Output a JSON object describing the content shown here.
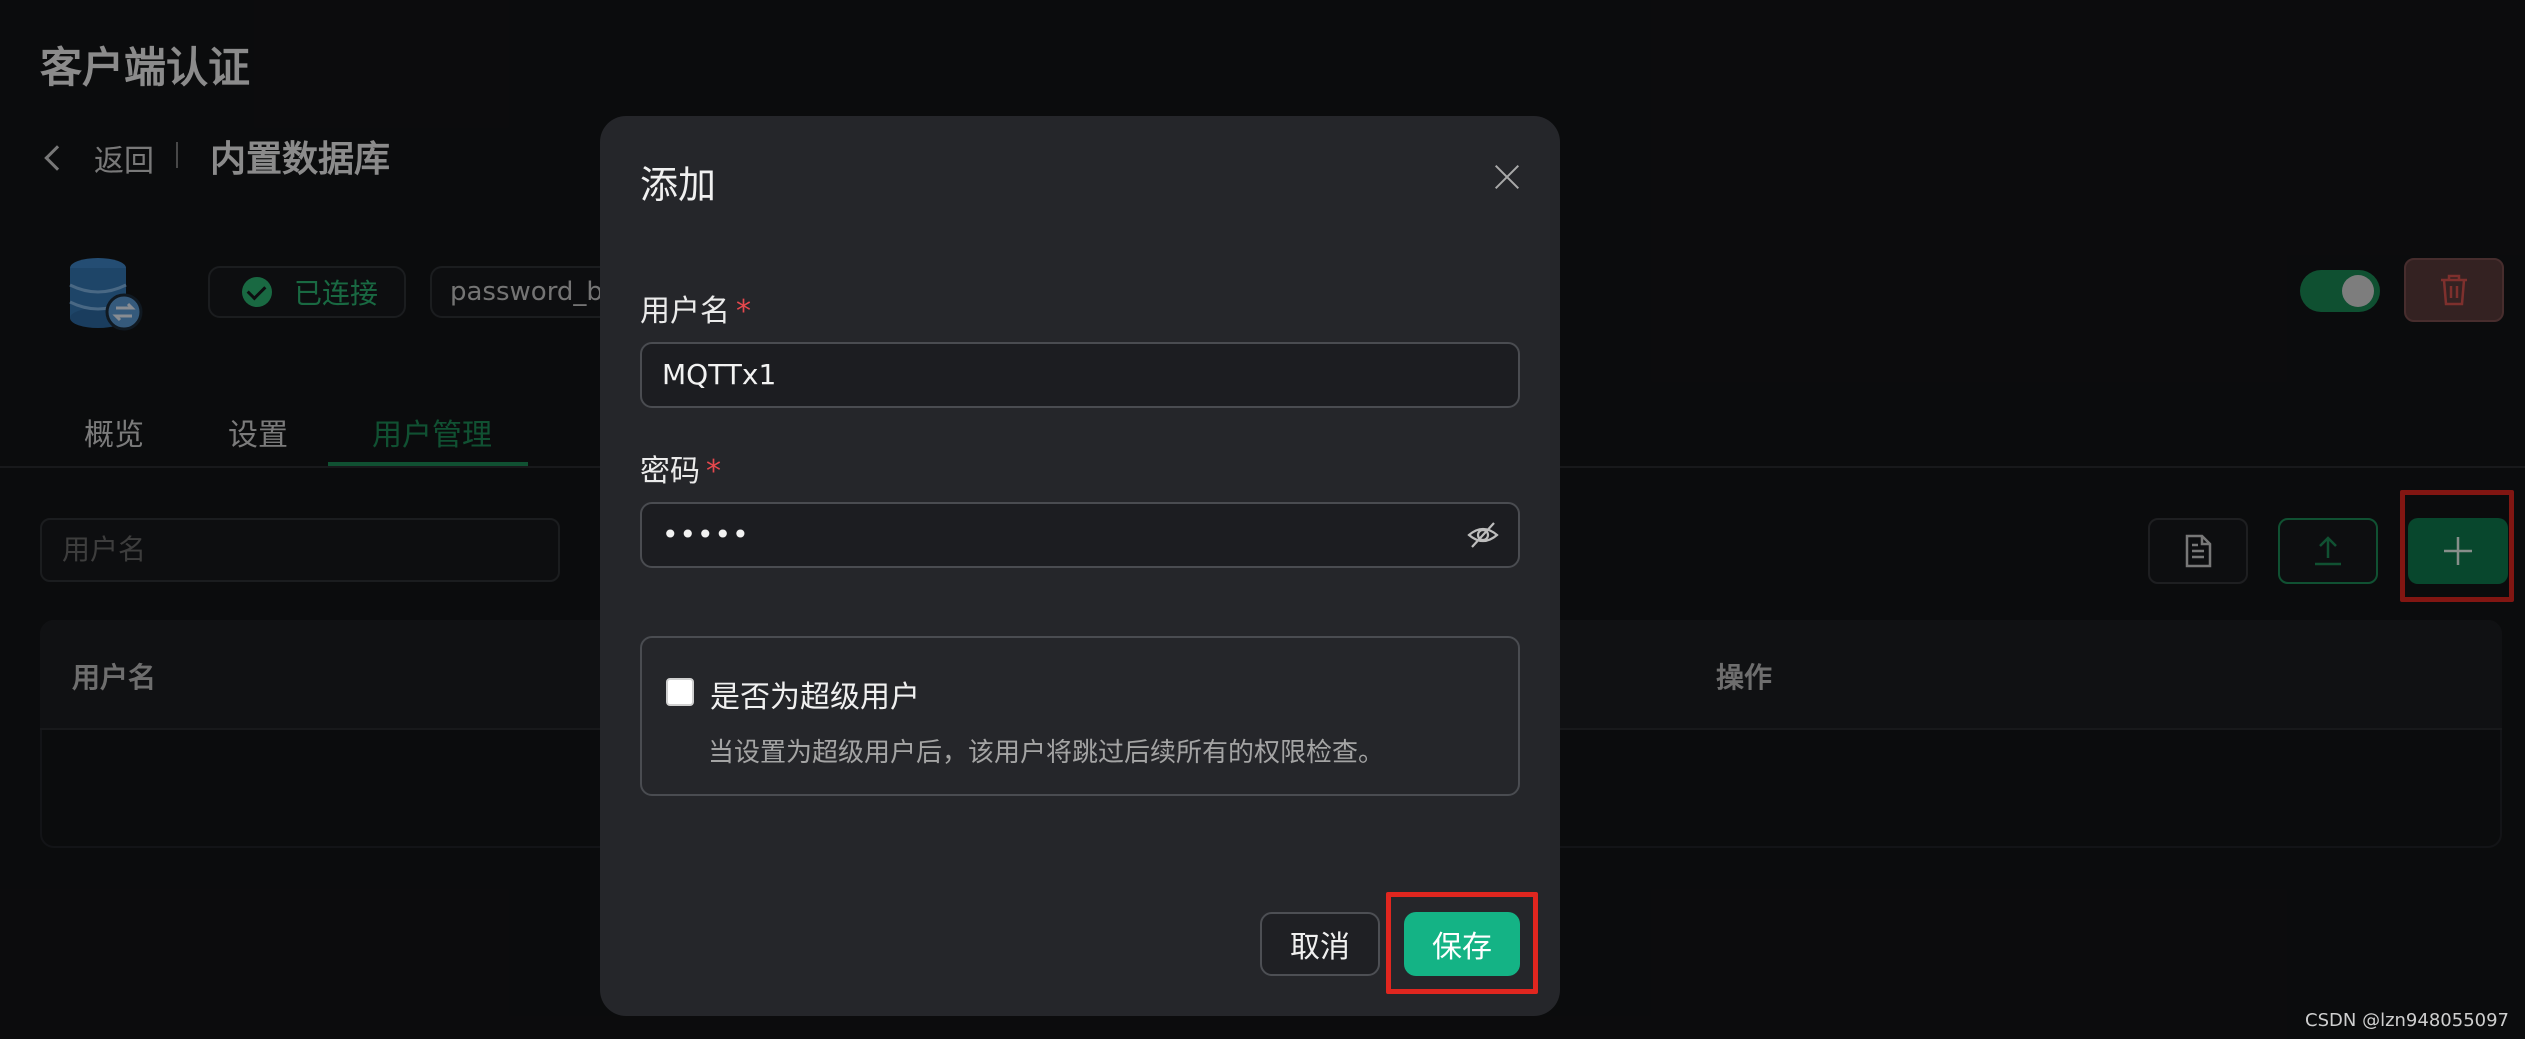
{
  "page": {
    "title": "客户端认证",
    "back_label": "返回",
    "db_title": "内置数据库",
    "status_label": "已连接",
    "mechanism_label": "password_based",
    "enabled": true
  },
  "tabs": [
    {
      "label": "概览",
      "active": false
    },
    {
      "label": "设置",
      "active": false
    },
    {
      "label": "用户管理",
      "active": true
    }
  ],
  "search": {
    "placeholder": "用户名"
  },
  "table": {
    "columns": [
      "用户名",
      "操作"
    ],
    "rows": []
  },
  "dialog": {
    "title": "添加",
    "username": {
      "label": "用户名",
      "required_mark": "*",
      "value": "MQTTx1"
    },
    "password": {
      "label": "密码",
      "required_mark": "*",
      "value": "•••••"
    },
    "superuser": {
      "label": "是否为超级用户",
      "hint": "当设置为超级用户后，该用户将跳过后续所有的权限检查。",
      "checked": false
    },
    "cancel_label": "取消",
    "save_label": "保存"
  },
  "colors": {
    "accent": "#1d8c57",
    "primary_button": "#14b385",
    "highlight_box": "#e0261f",
    "required": "#e5484d"
  },
  "watermark": "CSDN @lzn948055097"
}
